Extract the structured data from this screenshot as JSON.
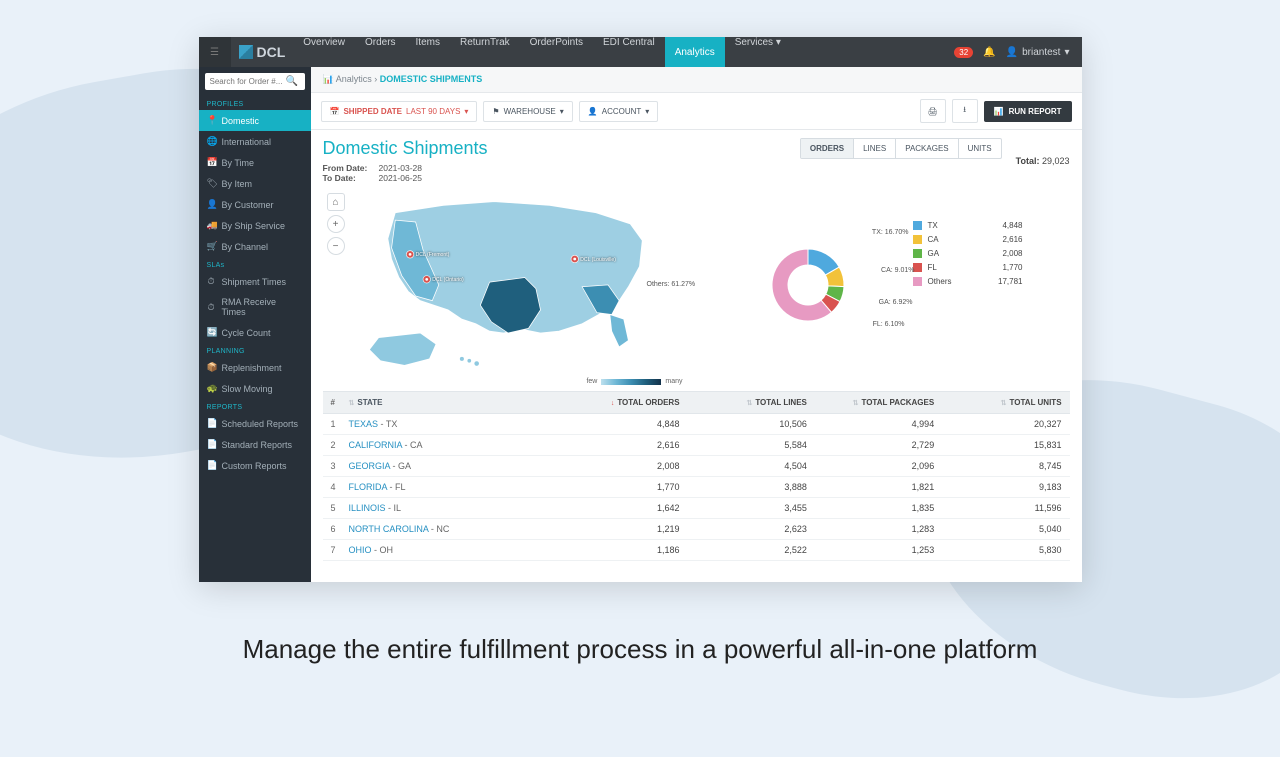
{
  "caption": "Manage the entire fulfillment process in a powerful all-in-one platform",
  "brand": "DCL",
  "nav": [
    "Overview",
    "Orders",
    "Items",
    "ReturnTrak",
    "OrderPoints",
    "EDI Central",
    "Analytics",
    "Services ▾"
  ],
  "nav_active": "Analytics",
  "user": {
    "badge": "32",
    "name": "briantest"
  },
  "search": {
    "placeholder": "Search for Order #..."
  },
  "sidebar": {
    "sections": [
      {
        "label": "PROFILES",
        "items": [
          {
            "icon": "📍",
            "label": "Domestic",
            "active": true
          },
          {
            "icon": "🌐",
            "label": "International"
          },
          {
            "icon": "📅",
            "label": "By Time"
          },
          {
            "icon": "🏷",
            "label": "By Item"
          },
          {
            "icon": "👤",
            "label": "By Customer"
          },
          {
            "icon": "🚚",
            "label": "By Ship Service"
          },
          {
            "icon": "🛒",
            "label": "By Channel"
          }
        ]
      },
      {
        "label": "SLAs",
        "items": [
          {
            "icon": "⏱",
            "label": "Shipment Times"
          },
          {
            "icon": "⏱",
            "label": "RMA Receive Times"
          },
          {
            "icon": "🔄",
            "label": "Cycle Count"
          }
        ]
      },
      {
        "label": "PLANNING",
        "items": [
          {
            "icon": "📦",
            "label": "Replenishment"
          },
          {
            "icon": "🐢",
            "label": "Slow Moving"
          }
        ]
      },
      {
        "label": "REPORTS",
        "items": [
          {
            "icon": "📄",
            "label": "Scheduled Reports"
          },
          {
            "icon": "📄",
            "label": "Standard Reports"
          },
          {
            "icon": "📄",
            "label": "Custom Reports"
          }
        ]
      }
    ]
  },
  "breadcrumb": {
    "root": "Analytics",
    "current": "DOMESTIC SHIPMENTS"
  },
  "toolbar": {
    "shipped_label": "SHIPPED DATE",
    "shipped_range": "LAST 90 DAYS",
    "warehouse": "WAREHOUSE",
    "account": "ACCOUNT",
    "run": "RUN REPORT"
  },
  "header": {
    "title": "Domestic Shipments",
    "from_label": "From Date:",
    "from": "2021-03-28",
    "to_label": "To Date:",
    "to": "2021-06-25",
    "tabs": [
      "ORDERS",
      "LINES",
      "PACKAGES",
      "UNITS"
    ],
    "tab_active": "ORDERS",
    "total_label": "Total:",
    "total": "29,023"
  },
  "map": {
    "legend_low": "few",
    "legend_high": "many",
    "pins": [
      {
        "label": "DCL (Fremont)"
      },
      {
        "label": "DCL (Ontario)"
      },
      {
        "label": "DCL (Louisville)"
      }
    ]
  },
  "chart_data": {
    "type": "pie",
    "title": "",
    "series": [
      {
        "name": "TX",
        "pct": 16.7,
        "value": 4848,
        "color": "#4fa9de"
      },
      {
        "name": "CA",
        "pct": 9.01,
        "value": 2616,
        "color": "#f2c23a"
      },
      {
        "name": "GA",
        "pct": 6.92,
        "value": 2008,
        "color": "#5fb548"
      },
      {
        "name": "FL",
        "pct": 6.1,
        "value": 1770,
        "color": "#d9534f"
      },
      {
        "name": "Others",
        "pct": 61.27,
        "value": 17781,
        "color": "#e79ac2"
      }
    ],
    "labels": [
      "TX: 16.70%",
      "CA: 9.01%",
      "GA: 6.92%",
      "FL: 6.10%",
      "Others: 61.27%"
    ]
  },
  "table": {
    "columns": [
      "#",
      "STATE",
      "TOTAL ORDERS",
      "TOTAL LINES",
      "TOTAL PACKAGES",
      "TOTAL UNITS"
    ],
    "rows": [
      {
        "n": 1,
        "state": "TEXAS",
        "ab": "TX",
        "orders": "4,848",
        "lines": "10,506",
        "packages": "4,994",
        "units": "20,327"
      },
      {
        "n": 2,
        "state": "CALIFORNIA",
        "ab": "CA",
        "orders": "2,616",
        "lines": "5,584",
        "packages": "2,729",
        "units": "15,831"
      },
      {
        "n": 3,
        "state": "GEORGIA",
        "ab": "GA",
        "orders": "2,008",
        "lines": "4,504",
        "packages": "2,096",
        "units": "8,745"
      },
      {
        "n": 4,
        "state": "FLORIDA",
        "ab": "FL",
        "orders": "1,770",
        "lines": "3,888",
        "packages": "1,821",
        "units": "9,183"
      },
      {
        "n": 5,
        "state": "ILLINOIS",
        "ab": "IL",
        "orders": "1,642",
        "lines": "3,455",
        "packages": "1,835",
        "units": "11,596"
      },
      {
        "n": 6,
        "state": "NORTH CAROLINA",
        "ab": "NC",
        "orders": "1,219",
        "lines": "2,623",
        "packages": "1,283",
        "units": "5,040"
      },
      {
        "n": 7,
        "state": "OHIO",
        "ab": "OH",
        "orders": "1,186",
        "lines": "2,522",
        "packages": "1,253",
        "units": "5,830"
      }
    ]
  }
}
